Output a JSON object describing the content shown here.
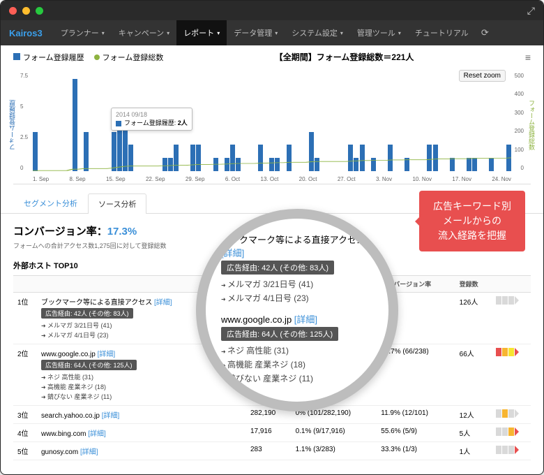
{
  "brand": "Kairos3",
  "nav": [
    "プランナー",
    "キャンペーン",
    "レポート",
    "データ管理",
    "システム設定",
    "管理ツール",
    "チュートリアル"
  ],
  "nav_active_index": 2,
  "chart": {
    "legend_bar": "フォーム登録履歴",
    "legend_line": "フォーム登録総数",
    "title": "【全期間】フォーム登録総数＝221人",
    "reset": "Reset zoom",
    "ylabel_left": "フォーム登録履歴",
    "ylabel_right": "フォーム登録総数",
    "tooltip_date": "2014 09/18",
    "tooltip_series": "フォーム登録履歴:",
    "tooltip_value": "2人",
    "xticks": [
      "1. Sep",
      "8. Sep",
      "15. Sep",
      "22. Sep",
      "29. Sep",
      "6. Oct",
      "13. Oct",
      "20. Oct",
      "27. Oct",
      "3. Nov",
      "10. Nov",
      "17. Nov",
      "24. Nov"
    ],
    "yticks_left": [
      "7.5",
      "5",
      "2.5",
      "0"
    ],
    "yticks_right": [
      "500",
      "400",
      "300",
      "200",
      "100",
      "0"
    ]
  },
  "tabs": {
    "segment": "セグメント分析",
    "source": "ソース分析"
  },
  "summary": {
    "label": "コンバージョン率：",
    "rate": "17.3%",
    "sub_prefix": "フォームへの合計アクセス数",
    "sub_count": "1,275回",
    "sub_suffix": "に対して登録総数"
  },
  "table": {
    "title": "外部ホスト TOP10",
    "headers": {
      "rank": "",
      "host": "",
      "pv": "",
      "unique": "",
      "conv": "コンバージョン率",
      "reg": "登録数",
      "heat": ""
    },
    "detail": "[詳細]",
    "rows": [
      {
        "rank": "1位",
        "host": "ブックマーク等による直接アクセス",
        "pill": "広告経由: 42人 (その他: 83人)",
        "subs": [
          "メルマガ 3/21日号 (41)",
          "メルマガ 4/1日号 (23)"
        ],
        "conv": "-",
        "reg": "126人",
        "heat": [
          "#d9d9d9",
          "#d9d9d9",
          "#d9d9d9"
        ],
        "arrow": "#d9d9d9"
      },
      {
        "rank": "2位",
        "host": "www.google.co.jp",
        "pill": "広告経由: 64人 (その他: 125人)",
        "subs": [
          "ネジ 高性能 (31)",
          "高機能 産業ネジ (18)",
          "錆びない 産業ネジ (11)"
        ],
        "unique_tail": "11)",
        "conv": "27.7% (66/238)",
        "reg": "66人",
        "heat": [
          "#e84f4f",
          "#f7b531",
          "#f7e531"
        ],
        "arrow": "#e84f4f"
      },
      {
        "rank": "3位",
        "host": "search.yahoo.co.jp",
        "pv": "282,190",
        "unique": "0% (101/282,190)",
        "conv": "11.9% (12/101)",
        "reg": "12人",
        "heat": [
          "#d9d9d9",
          "#f7b531",
          "#d9d9d9"
        ],
        "arrow": "#d9d9d9"
      },
      {
        "rank": "4位",
        "host": "www.bing.com",
        "pv": "17,916",
        "unique": "0.1% (9/17,916)",
        "conv": "55.6% (5/9)",
        "reg": "5人",
        "heat": [
          "#d9d9d9",
          "#d9d9d9",
          "#f7b531"
        ],
        "arrow": "#e84f4f"
      },
      {
        "rank": "5位",
        "host": "gunosy.com",
        "pv": "283",
        "unique": "1.1% (3/283)",
        "conv": "33.3% (1/3)",
        "reg": "1人",
        "heat": [
          "#d9d9d9",
          "#d9d9d9",
          "#d9d9d9"
        ],
        "arrow": "#e84f4f"
      }
    ]
  },
  "magnifier": {
    "host1": "ブックマーク等による直接アクセス",
    "pill1": "広告経由: 42人 (その他: 83人)",
    "subs1": [
      "メルマガ 3/21日号 (41)",
      "メルマガ 4/1日号 (23)"
    ],
    "host2": "www.google.co.jp",
    "pill2": "広告経由: 64人 (その他: 125人)",
    "subs2": [
      "ネジ 高性能 (31)",
      "高機能 産業ネジ (18)",
      "錆びない 産業ネジ (11)"
    ],
    "host3": "ahoo.co.jp"
  },
  "callout": {
    "l1": "広告キーワード別",
    "l2": "メールからの",
    "l3": "流入経路を把握"
  },
  "chart_data": {
    "type": "bar+line",
    "x": [
      "1.Sep",
      "2",
      "3",
      "4",
      "5",
      "6",
      "7",
      "8.Sep",
      "9",
      "10",
      "11",
      "12",
      "13",
      "14",
      "15.Sep",
      "16",
      "17",
      "18",
      "19",
      "20",
      "21",
      "22.Sep",
      "23",
      "24",
      "25",
      "26",
      "27",
      "28",
      "29.Sep",
      "30",
      "1",
      "2",
      "3",
      "4",
      "5",
      "6.Oct",
      "7",
      "8",
      "9",
      "10",
      "11",
      "12",
      "13.Oct",
      "14",
      "15",
      "16",
      "17",
      "18",
      "19",
      "20.Oct",
      "21",
      "22",
      "23",
      "24",
      "25",
      "26",
      "27.Oct",
      "28",
      "29",
      "30",
      "31",
      "1",
      "2",
      "3.Nov",
      "4",
      "5",
      "6",
      "7",
      "8",
      "9",
      "10.Nov",
      "11",
      "12",
      "13",
      "14",
      "15",
      "16",
      "17.Nov",
      "18",
      "19",
      "20",
      "21",
      "22",
      "23",
      "24.Nov"
    ],
    "bars": [
      3,
      0,
      0,
      0,
      0,
      0,
      0,
      7,
      0,
      3,
      0,
      0,
      0,
      0,
      3,
      4,
      4,
      2,
      0,
      0,
      0,
      0,
      0,
      1,
      1,
      2,
      0,
      0,
      2,
      2,
      0,
      0,
      1,
      0,
      1,
      2,
      1,
      0,
      0,
      0,
      2,
      0,
      1,
      1,
      0,
      2,
      0,
      0,
      0,
      3,
      1,
      0,
      0,
      0,
      0,
      0,
      2,
      1,
      2,
      0,
      1,
      0,
      0,
      2,
      0,
      0,
      1,
      0,
      0,
      0,
      2,
      2,
      0,
      0,
      1,
      0,
      0,
      1,
      1,
      0,
      0,
      1,
      0,
      0,
      2
    ],
    "line_cumulative_approx": [
      3,
      3,
      3,
      3,
      3,
      3,
      3,
      10,
      10,
      13,
      13,
      13,
      13,
      13,
      16,
      20,
      24,
      26,
      26,
      26,
      26,
      26,
      26,
      27,
      28,
      30,
      30,
      30,
      32,
      34,
      34,
      34,
      35,
      35,
      36,
      38,
      39,
      39,
      39,
      39,
      41,
      41,
      42,
      43,
      43,
      45,
      45,
      45,
      45,
      48,
      49,
      49,
      49,
      49,
      49,
      49,
      51,
      52,
      54,
      54,
      55,
      55,
      55,
      57,
      57,
      57,
      58,
      58,
      58,
      58,
      60,
      62,
      62,
      62,
      63,
      63,
      63,
      64,
      65,
      65,
      65,
      66,
      66,
      66,
      68
    ],
    "ylabel_left": "フォーム登録履歴",
    "ylabel_right": "フォーム登録総数",
    "ylim_left": [
      0,
      7.5
    ],
    "ylim_right": [
      0,
      500
    ]
  }
}
